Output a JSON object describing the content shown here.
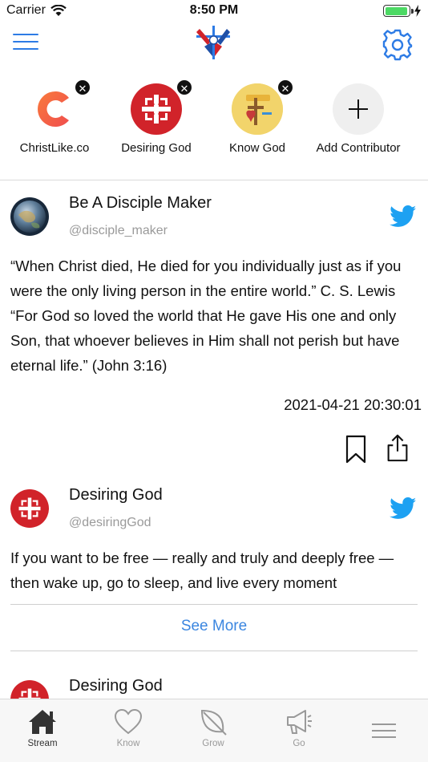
{
  "status_bar": {
    "carrier": "Carrier",
    "time": "8:50 PM",
    "battery_level": 0.95
  },
  "nav": {
    "menu_icon": "hamburger-icon",
    "logo_icon": "cross-logo-icon",
    "settings_icon": "gear-icon"
  },
  "contributors": [
    {
      "label": "ChristLike.co",
      "icon": "christlike-logo",
      "removable": true
    },
    {
      "label": "Desiring God",
      "icon": "desiring-god-logo",
      "removable": true
    },
    {
      "label": "Know God",
      "icon": "know-god-logo",
      "removable": true
    },
    {
      "label": "Add Contributor",
      "icon": "plus-icon",
      "removable": false
    }
  ],
  "remove_glyph": "✕",
  "posts": [
    {
      "author": "Be A Disciple Maker",
      "handle": "@disciple_maker",
      "text": "“When Christ died, He died for you individually just as if you were the only living person in the entire world.” C. S. Lewis “For God so loved the world that He gave His one and only Son, that whoever believes in Him shall not perish but have eternal life.” (John 3:16)",
      "date": "2021-04-21 20:30:01"
    },
    {
      "author": "Desiring God",
      "handle": "@desiringGod",
      "text": "If you want to be free — really and truly and deeply free — then wake up, go to sleep, and live every moment",
      "see_more": "See More"
    },
    {
      "author": "Desiring God"
    }
  ],
  "tabs": [
    {
      "label": "Stream",
      "icon": "home-icon",
      "active": true
    },
    {
      "label": "Know",
      "icon": "heart-icon",
      "active": false
    },
    {
      "label": "Grow",
      "icon": "leaf-icon",
      "active": false
    },
    {
      "label": "Go",
      "icon": "megaphone-icon",
      "active": false
    },
    {
      "label": "",
      "icon": "more-menu-icon",
      "active": false
    }
  ],
  "colors": {
    "accent": "#2d7be5",
    "link": "#3b86e0",
    "twitter": "#1da1f2",
    "desiring_god_red": "#d1232a"
  }
}
